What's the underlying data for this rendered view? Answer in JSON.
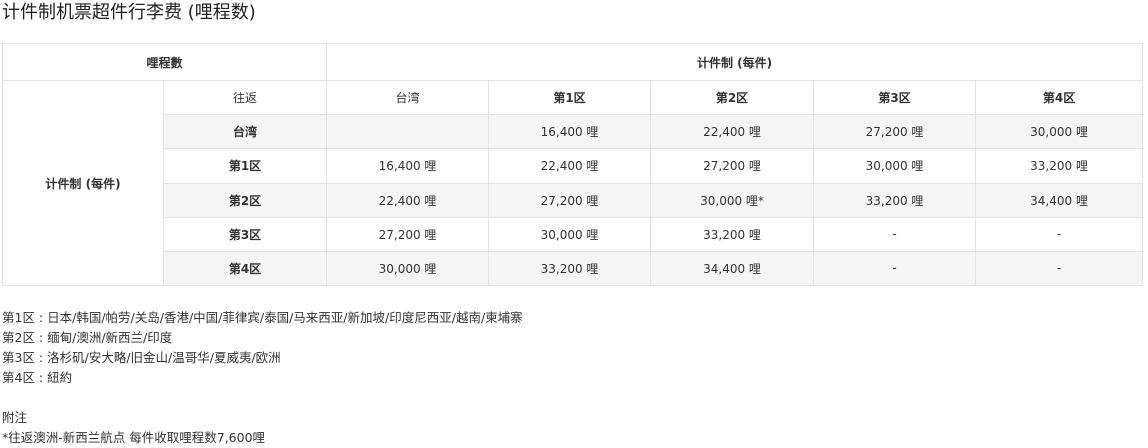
{
  "title": "计件制机票超件行李费 (哩程数)",
  "table": {
    "header_left": "哩程數",
    "header_right": "计件制 (每件)",
    "row_group_label": "计件制 (每件)",
    "corner_label": "往返",
    "columns": [
      "台湾",
      "第1区",
      "第2区",
      "第3区",
      "第4区"
    ],
    "rows": [
      {
        "label": "台湾",
        "cells": [
          "",
          "16,400 哩",
          "22,400 哩",
          "27,200 哩",
          "30,000 哩"
        ]
      },
      {
        "label": "第1区",
        "cells": [
          "16,400 哩",
          "22,400 哩",
          "27,200 哩",
          "30,000 哩",
          "33,200 哩"
        ]
      },
      {
        "label": "第2区",
        "cells": [
          "22,400 哩",
          "27,200 哩",
          "30,000 哩*",
          "33,200 哩",
          "34,400 哩"
        ]
      },
      {
        "label": "第3区",
        "cells": [
          "27,200 哩",
          "30,000 哩",
          "33,200 哩",
          "-",
          "-"
        ]
      },
      {
        "label": "第4区",
        "cells": [
          "30,000 哩",
          "33,200 哩",
          "34,400 哩",
          "-",
          "-"
        ]
      }
    ]
  },
  "zones": [
    "第1区 : 日本/韩国/帕劳/关岛/香港/中国/菲律宾/泰国/马来西亚/新加坡/印度尼西亚/越南/柬埔寨",
    "第2区 : 缅甸/澳洲/新西兰/印度",
    "第3区 : 洛杉矶/安大略/旧金山/温哥华/夏威夷/欧洲",
    "第4区 : 紐約"
  ],
  "note_title": "附注",
  "note_text": "*往返澳洲-新西兰航点 每件收取哩程数7,600哩"
}
